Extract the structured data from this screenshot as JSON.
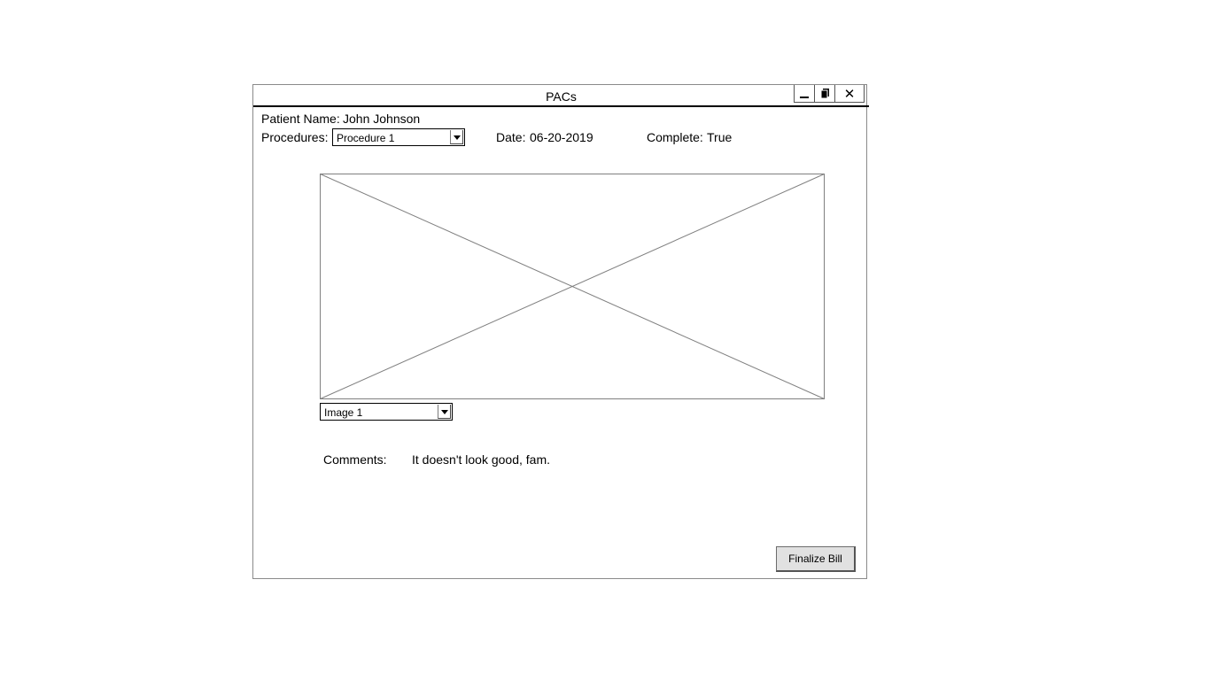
{
  "window": {
    "title": "PACs",
    "close_glyph": "✕",
    "buttons": [
      "minimize-icon",
      "restore-icon",
      "close-icon"
    ]
  },
  "patient": {
    "name_label": "Patient Name:",
    "name_value": "John Johnson"
  },
  "procedures": {
    "label": "Procedures:",
    "selected": "Procedure 1"
  },
  "date": {
    "label": "Date:",
    "value": "06-20-2019"
  },
  "complete": {
    "label": "Complete:",
    "value": "True"
  },
  "image_select": {
    "selected": "Image 1"
  },
  "comments": {
    "label": "Comments:",
    "value": "It doesn't look good, fam."
  },
  "actions": {
    "finalize_label": "Finalize Bill"
  }
}
